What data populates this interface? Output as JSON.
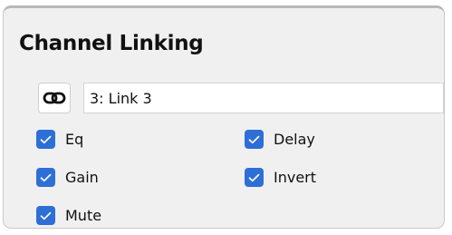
{
  "panel": {
    "title": "Channel Linking"
  },
  "link": {
    "icon": "chain-link-icon",
    "value": "3: Link 3"
  },
  "options": [
    {
      "label": "Eq",
      "checked": true
    },
    {
      "label": "Delay",
      "checked": true
    },
    {
      "label": "Gain",
      "checked": true
    },
    {
      "label": "Invert",
      "checked": true
    },
    {
      "label": "Mute",
      "checked": true
    }
  ],
  "colors": {
    "checkbox_accent": "#2e6fd6",
    "panel_background": "#f0f0f0"
  }
}
